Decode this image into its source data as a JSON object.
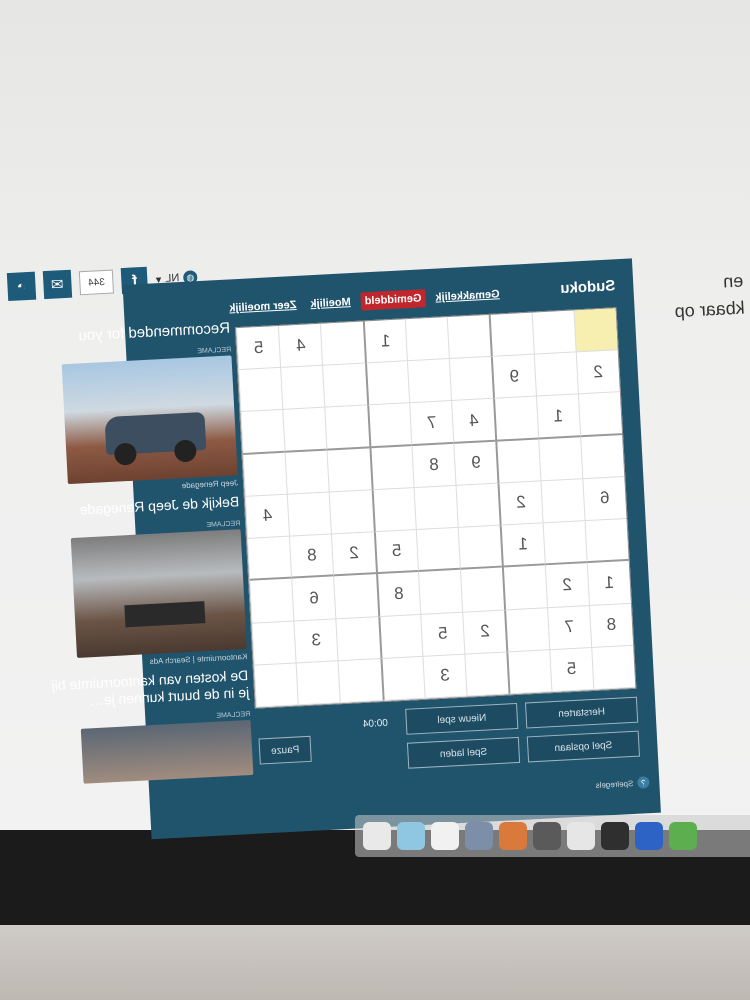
{
  "toolbar": {
    "language": "NL",
    "facebook_count": "344"
  },
  "sidetext": {
    "heading_fragment": "en",
    "subheading_fragment": "kbaar op"
  },
  "sudoku": {
    "title": "Sudoku",
    "tabs": [
      {
        "label": "Gemakkelijk",
        "active": false
      },
      {
        "label": "Gemiddeld",
        "active": true
      },
      {
        "label": "Moeilijk",
        "active": false
      },
      {
        "label": "Zeer moeilijk",
        "active": false
      }
    ],
    "grid": [
      [
        "",
        "",
        "",
        "",
        "",
        "1",
        "",
        "4",
        "5"
      ],
      [
        "2",
        "",
        "9",
        "",
        "",
        "",
        "",
        "",
        ""
      ],
      [
        "",
        "1",
        "",
        "4",
        "7",
        "",
        "",
        "",
        ""
      ],
      [
        "",
        "",
        "",
        "9",
        "8",
        "",
        "",
        "",
        ""
      ],
      [
        "6",
        "",
        "2",
        "",
        "",
        "",
        "",
        "",
        "4"
      ],
      [
        "",
        "",
        "1",
        "",
        "",
        "5",
        "2",
        "8",
        ""
      ],
      [
        "1",
        "2",
        "",
        "",
        "",
        "8",
        "",
        "6",
        ""
      ],
      [
        "8",
        "7",
        "",
        "2",
        "5",
        "",
        "",
        "3",
        ""
      ],
      [
        "",
        "5",
        "",
        "",
        "3",
        "",
        "",
        "",
        ""
      ]
    ],
    "selected_cell": [
      0,
      0
    ],
    "buttons": {
      "reset": "Herstarten",
      "new_game": "Nieuw spel",
      "save": "Spel opslaan",
      "load": "Spel laden",
      "pause": "Pauze"
    },
    "timer": "00:04",
    "footnote": "Spelregels"
  },
  "sidebar": {
    "title": "Recommended for you",
    "ads": [
      {
        "label": "RECLAME",
        "source": "Jeep Renegade",
        "caption": "Bekijk de Jeep Renegade"
      },
      {
        "label": "RECLAME",
        "source": "Kantoorruimte | Search Ads",
        "caption": "De kosten van kantoorruimte bij je in de buurt kunnen je…"
      },
      {
        "label": "RECLAME",
        "source": "",
        "caption": ""
      }
    ]
  }
}
